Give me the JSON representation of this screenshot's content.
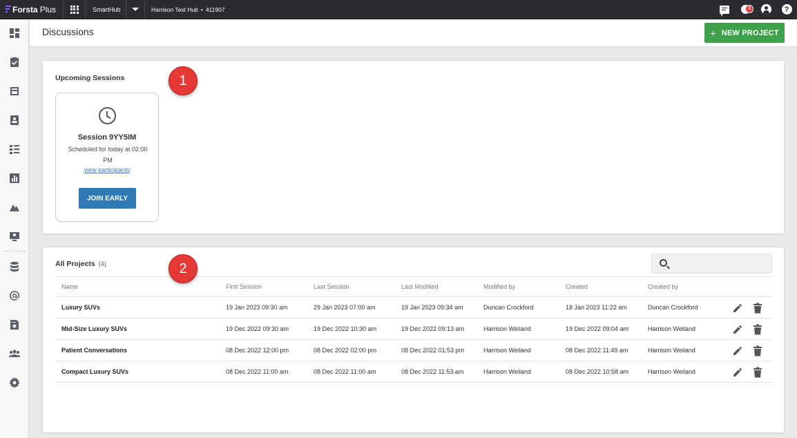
{
  "topbar": {
    "brand": "Forsta",
    "brand_suffix": "Plus",
    "hub_menu": "SmartHub",
    "hub_name": "Harrison Test Hub",
    "hub_separator": "•",
    "hub_id": "411907",
    "notification_count": "3",
    "icons": [
      "apps-grid-icon",
      "chat-icon",
      "notifications-icon",
      "user-account-icon",
      "help-icon"
    ]
  },
  "sidebar": {
    "icons": [
      "dashboard-icon",
      "tasks-icon",
      "page-icon",
      "contacts-icon",
      "list-icon",
      "reports-icon",
      "chart-icon",
      "presentation-icon",
      "database-icon",
      "email-icon",
      "search-report-icon",
      "users-icon",
      "settings-icon"
    ]
  },
  "header": {
    "title": "Discussions",
    "new_project_label": "NEW PROJECT"
  },
  "upcoming": {
    "title": "Upcoming Sessions",
    "session": {
      "name": "Session 9YY5IM",
      "schedule": "Scheduled for today at 02:00 PM",
      "link": "view participants",
      "join_label": "JOIN EARLY"
    }
  },
  "projects": {
    "title": "All Projects",
    "count": "(4)",
    "search_placeholder": "",
    "columns": [
      "Name",
      "First Session",
      "Last Session",
      "Last Modified",
      "Modified by",
      "Created",
      "Created by"
    ],
    "rows": [
      [
        "Luxury SUVs",
        "19 Jan 2023 09:30 am",
        "29 Jan 2023 07:00 am",
        "19 Jan 2023 09:34 am",
        "Duncan Crockford",
        "18 Jan 2023 11:22 am",
        "Duncan Crockford"
      ],
      [
        "Mid-Size Luxury SUVs",
        "19 Dec 2022 09:30 am",
        "19 Dec 2022 10:30 am",
        "19 Dec 2022 09:13 am",
        "Harrison Weiland",
        "19 Dec 2022 09:04 am",
        "Harrison Weiland"
      ],
      [
        "Patient Conversations",
        "08 Dec 2022 12:00 pm",
        "08 Dec 2022 02:00 pm",
        "08 Dec 2022 01:53 pm",
        "Harrison Weiland",
        "08 Dec 2022 11:49 am",
        "Harrison Weiland"
      ],
      [
        "Compact Luxury SUVs",
        "08 Dec 2022 11:00 am",
        "08 Dec 2022 11:00 am",
        "08 Dec 2022 11:53 am",
        "Harrison Weiland",
        "08 Dec 2022 10:58 am",
        "Harrison Weiland"
      ]
    ]
  },
  "callouts": [
    "1",
    "2"
  ],
  "colors": {
    "topbar_bg": "#2b2c30",
    "primary_button": "#3fa24a",
    "join_button": "#2f79b7",
    "callout": "#e53935",
    "link": "#3b78b7"
  }
}
